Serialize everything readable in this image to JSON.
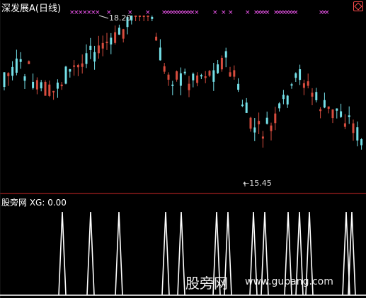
{
  "header": {
    "title": "深发展A(日线)",
    "settings_icon": "settings-icon"
  },
  "indicator_panel": {
    "title": "股旁网 XG: 0.00"
  },
  "annotations": {
    "high_label": "18.20",
    "low_label": "←15.45"
  },
  "watermark": {
    "text": "股旁网",
    "url": "www.gupang.com"
  },
  "colors": {
    "background": "#000000",
    "up_candle": "#d84c3e",
    "down_candle": "#74e0e8",
    "marker": "#ff5cff",
    "divider": "#8b1a1a",
    "signal_line": "#ffffff"
  }
}
